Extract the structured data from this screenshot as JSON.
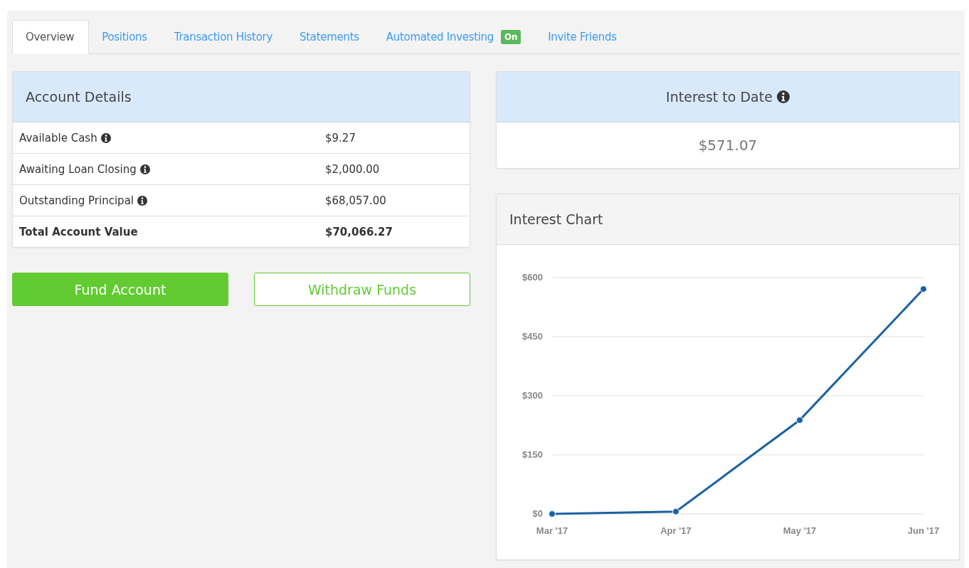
{
  "tabs": [
    {
      "label": "Overview",
      "selected": true
    },
    {
      "label": "Positions",
      "selected": false
    },
    {
      "label": "Transaction History",
      "selected": false
    },
    {
      "label": "Statements",
      "selected": false
    },
    {
      "label": "Automated Investing",
      "selected": false,
      "badge": "On"
    },
    {
      "label": "Invite Friends",
      "selected": false
    }
  ],
  "account_details": {
    "title": "Account Details",
    "rows": [
      {
        "label": "Available Cash",
        "value": "$9.27",
        "info": true,
        "total": false
      },
      {
        "label": "Awaiting Loan Closing",
        "value": "$2,000.00",
        "info": true,
        "total": false
      },
      {
        "label": "Outstanding Principal",
        "value": "$68,057.00",
        "info": true,
        "total": false
      },
      {
        "label": "Total Account Value",
        "value": "$70,066.27",
        "info": false,
        "total": true
      }
    ]
  },
  "buttons": [
    {
      "label": "Fund Account",
      "kind": "primary"
    },
    {
      "label": "Withdraw Funds",
      "kind": "outline"
    }
  ],
  "interest_to_date": {
    "title": "Interest to Date",
    "info": true,
    "value": "$571.07"
  },
  "interest_chart": {
    "title": "Interest Chart",
    "chart_data": {
      "type": "line",
      "categories": [
        "Mar '17",
        "Apr '17",
        "May '17",
        "Jun '17"
      ],
      "series": [
        {
          "color": "#1a62a3",
          "marker": "circle",
          "values": [
            0,
            6,
            238,
            571
          ]
        }
      ],
      "ylim": [
        0,
        600
      ],
      "grid": true,
      "yticks": [
        {
          "value": 0,
          "label": "$0"
        },
        {
          "value": 150,
          "label": "$150"
        },
        {
          "value": 300,
          "label": "$300"
        },
        {
          "value": 450,
          "label": "$450"
        },
        {
          "value": 600,
          "label": "$600"
        }
      ]
    }
  }
}
